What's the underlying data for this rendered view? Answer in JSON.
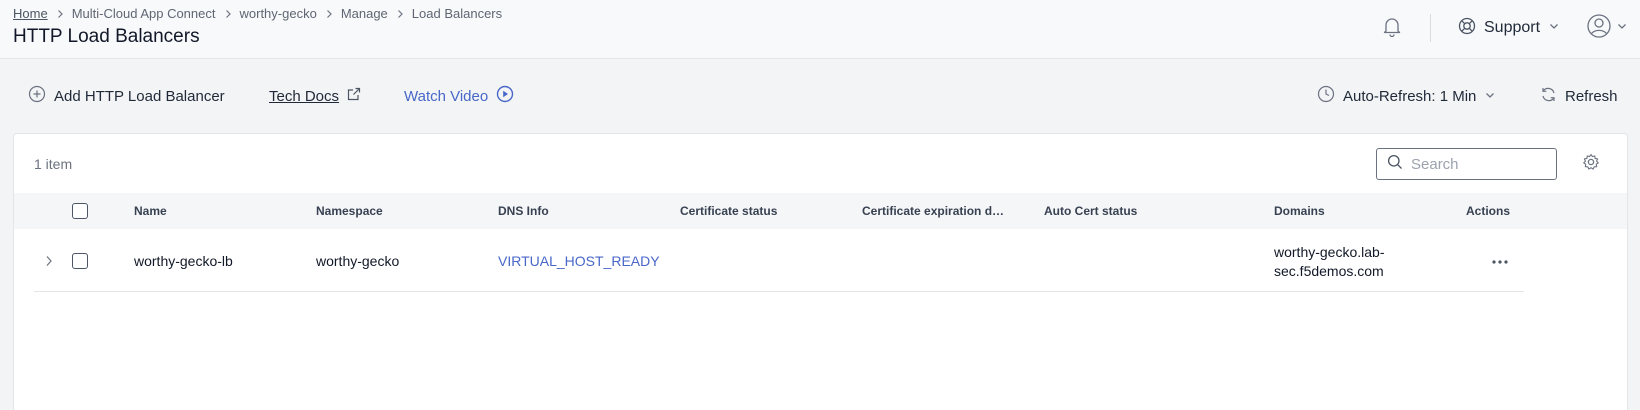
{
  "breadcrumb": {
    "items": [
      "Home",
      "Multi-Cloud App Connect",
      "worthy-gecko",
      "Manage",
      "Load Balancers"
    ]
  },
  "header": {
    "title": "HTTP Load Balancers",
    "support_label": "Support"
  },
  "toolbar": {
    "add_label": "Add HTTP Load Balancer",
    "docs_label": "Tech Docs",
    "video_label": "Watch Video",
    "auto_refresh_label": "Auto-Refresh: 1 Min",
    "refresh_label": "Refresh"
  },
  "table": {
    "count": "1 item",
    "search_placeholder": "Search",
    "columns": [
      "Name",
      "Namespace",
      "DNS Info",
      "Certificate status",
      "Certificate expiration date",
      "Auto Cert status",
      "Domains",
      "Actions"
    ],
    "rows": [
      {
        "name": "worthy-gecko-lb",
        "namespace": "worthy-gecko",
        "dns_info": "VIRTUAL_HOST_READY",
        "certificate_status": "",
        "certificate_expiration": "",
        "auto_cert_status": "",
        "domains_line1": "worthy-gecko.lab-",
        "domains_line2": "sec.f5demos.com"
      }
    ]
  },
  "colors": {
    "accent_link": "#4867c8",
    "header_bg": "#f8f9fb",
    "page_bg": "#f3f4f6"
  },
  "icons": [
    "bell-icon",
    "support-icon",
    "user-icon",
    "plus-circle-icon",
    "external-link-icon",
    "play-circle-icon",
    "clock-icon",
    "refresh-icon",
    "search-icon",
    "gear-icon",
    "chevron-right-icon",
    "more-horizontal-icon"
  ]
}
